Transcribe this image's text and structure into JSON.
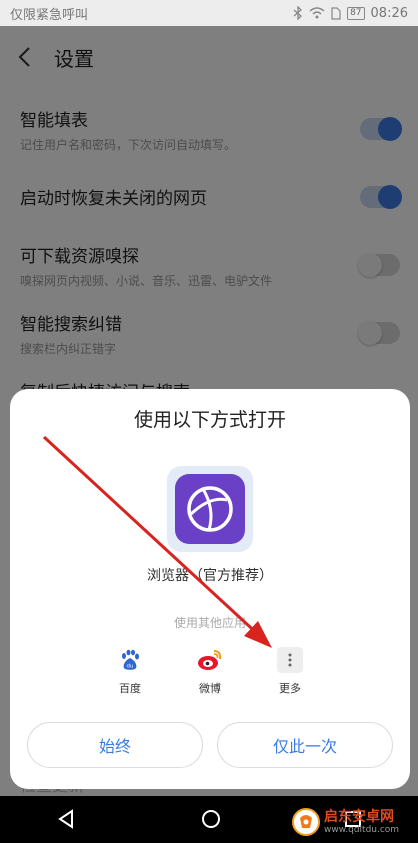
{
  "status_bar": {
    "left_text": "仅限紧急呼叫",
    "battery": "87",
    "time": "08:26"
  },
  "header": {
    "title": "设置"
  },
  "settings": [
    {
      "title": "智能填表",
      "desc": "记住用户名和密码，下次访问自动填写。",
      "enabled": true
    },
    {
      "title": "启动时恢复未关闭的网页",
      "desc": "",
      "enabled": true
    },
    {
      "title": "可下载资源嗅探",
      "desc": "嗅探网页内视频、小说、音乐、迅雷、电驴文件",
      "enabled": false
    },
    {
      "title": "智能搜索纠错",
      "desc": "搜索栏内纠正错字",
      "enabled": false
    },
    {
      "title": "复制后快捷访问与搜索",
      "desc": "",
      "enabled": false
    }
  ],
  "sheet": {
    "title": "使用以下方式打开",
    "default_app": "浏览器（官方推荐）",
    "other_label": "使用其他应用",
    "apps": [
      {
        "label": "百度",
        "icon": "baidu-icon"
      },
      {
        "label": "微博",
        "icon": "weibo-icon"
      },
      {
        "label": "更多",
        "icon": "more-icon"
      }
    ],
    "always_button": "始终",
    "once_button": "仅此一次"
  },
  "hidden_row": "检查更新",
  "watermark": {
    "title": "启东安卓网",
    "url": "www.qdltdu.com"
  },
  "colors": {
    "accent": "#3d7be6",
    "browser_purple": "#6a40c6",
    "annotation_red": "#d9231f"
  }
}
